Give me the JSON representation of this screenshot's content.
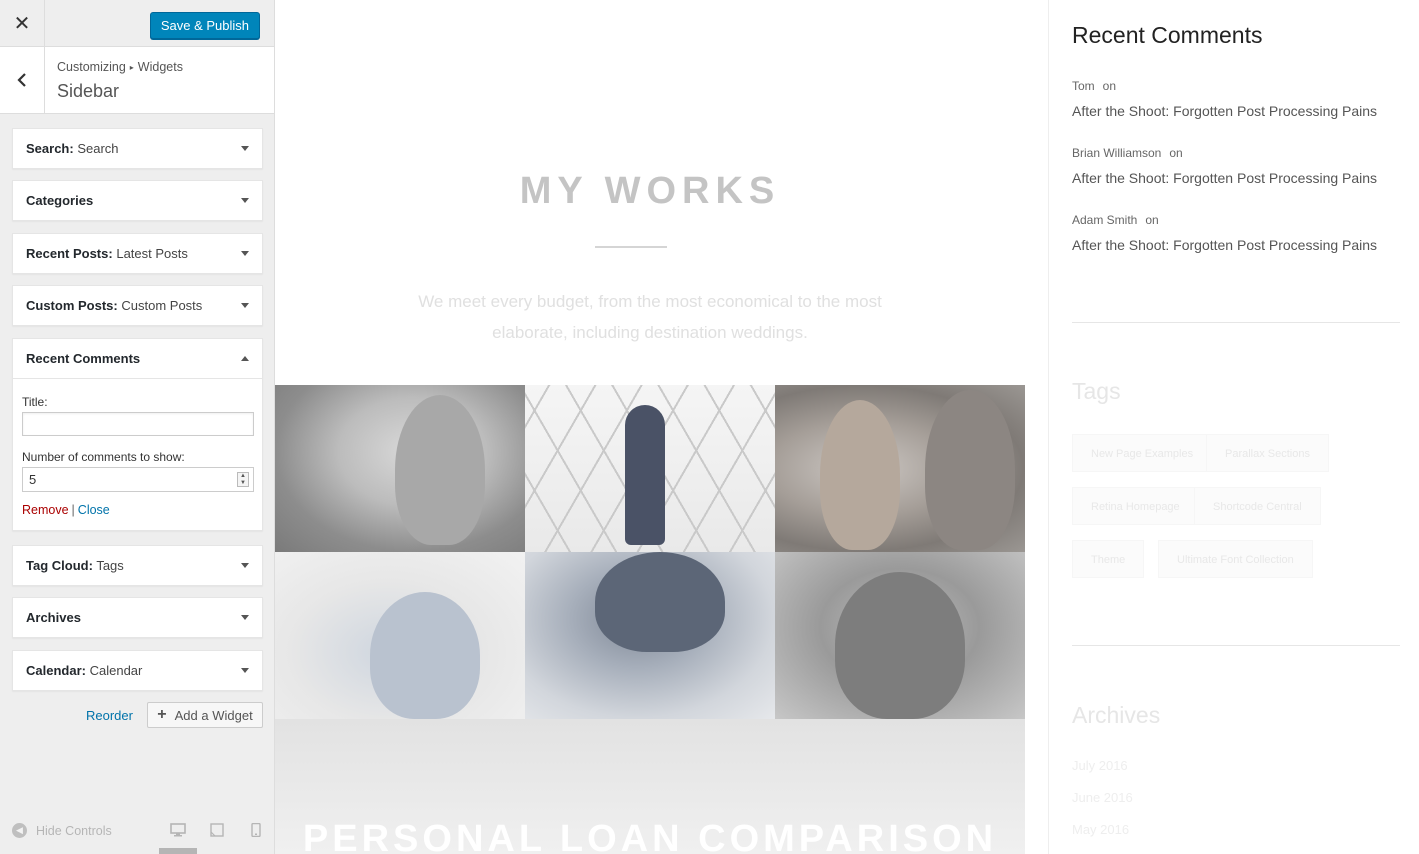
{
  "customizer": {
    "close_icon": "close-icon",
    "publish_label": "Save & Publish",
    "breadcrumb": [
      "Customizing",
      "Widgets"
    ],
    "breadcrumb_sep": "▸",
    "section_title": "Sidebar",
    "widgets": [
      {
        "name": "Search",
        "instance": "Search"
      },
      {
        "name": "Categories",
        "instance": ""
      },
      {
        "name": "Recent Posts",
        "instance": "Latest Posts"
      },
      {
        "name": "Custom Posts",
        "instance": "Custom Posts"
      },
      {
        "name": "Recent Comments",
        "instance": "",
        "expanded": true
      },
      {
        "name": "Tag Cloud",
        "instance": "Tags"
      },
      {
        "name": "Archives",
        "instance": ""
      },
      {
        "name": "Calendar",
        "instance": "Calendar"
      }
    ],
    "form": {
      "title_label": "Title:",
      "title_value": "",
      "count_label": "Number of comments to show:",
      "count_value": "5",
      "remove_label": "Remove",
      "separator": "|",
      "close_label": "Close"
    },
    "reorder_label": "Reorder",
    "add_widget_label": "Add a Widget",
    "hide_controls_label": "Hide Controls"
  },
  "preview": {
    "works_title": "MY WORKS",
    "works_text": "We meet every budget, from the most economical to the most elaborate, including destination weddings.",
    "loan_title": "PERSONAL LOAN COMPARISON",
    "recent_comments_title": "Recent Comments",
    "comments": [
      {
        "author": "Tom",
        "on": "on",
        "post": "After the Shoot: Forgotten Post Processing Pains"
      },
      {
        "author": "Brian Williamson",
        "on": "on",
        "post": "After the Shoot: Forgotten Post Processing Pains"
      },
      {
        "author": "Adam Smith",
        "on": "on",
        "post": "After the Shoot: Forgotten Post Processing Pains"
      }
    ],
    "tags_title": "Tags",
    "tags": [
      "New Page Examples",
      "Parallax Sections",
      "Retina Homepage",
      "Shortcode Central",
      "Theme",
      "Ultimate Font Collection"
    ],
    "archives_title": "Archives",
    "archives": [
      "July 2016",
      "June 2016",
      "May 2016"
    ]
  },
  "colors": {
    "accent": "#0085ba",
    "link": "#0073aa",
    "danger": "#aa0000"
  }
}
